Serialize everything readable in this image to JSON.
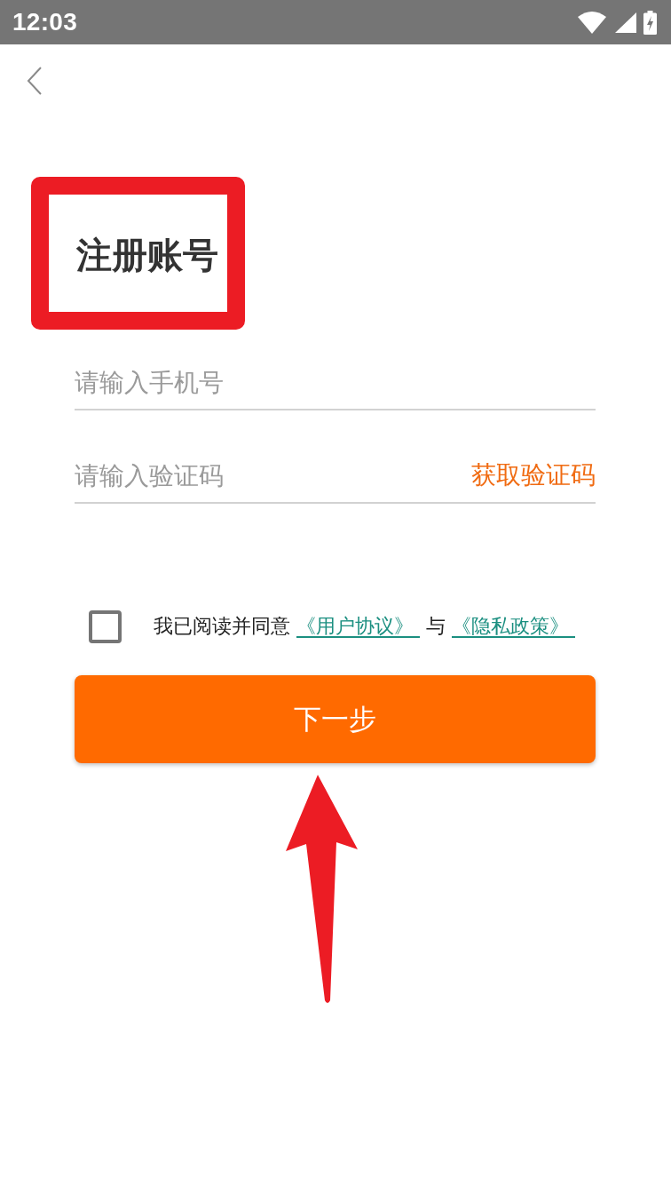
{
  "status_bar": {
    "time": "12:03"
  },
  "title": "注册账号",
  "fields": [
    {
      "placeholder": "请输入手机号"
    },
    {
      "placeholder": "请输入验证码",
      "action": "获取验证码"
    }
  ],
  "agreement": {
    "checked": false,
    "text": "我已阅读并同意",
    "links": [
      "《用户协议》",
      "《隐私政策》"
    ],
    "joiner": "与"
  },
  "next_button": "下一步",
  "annotations": {
    "title_frame": true,
    "button_arrow": true
  }
}
